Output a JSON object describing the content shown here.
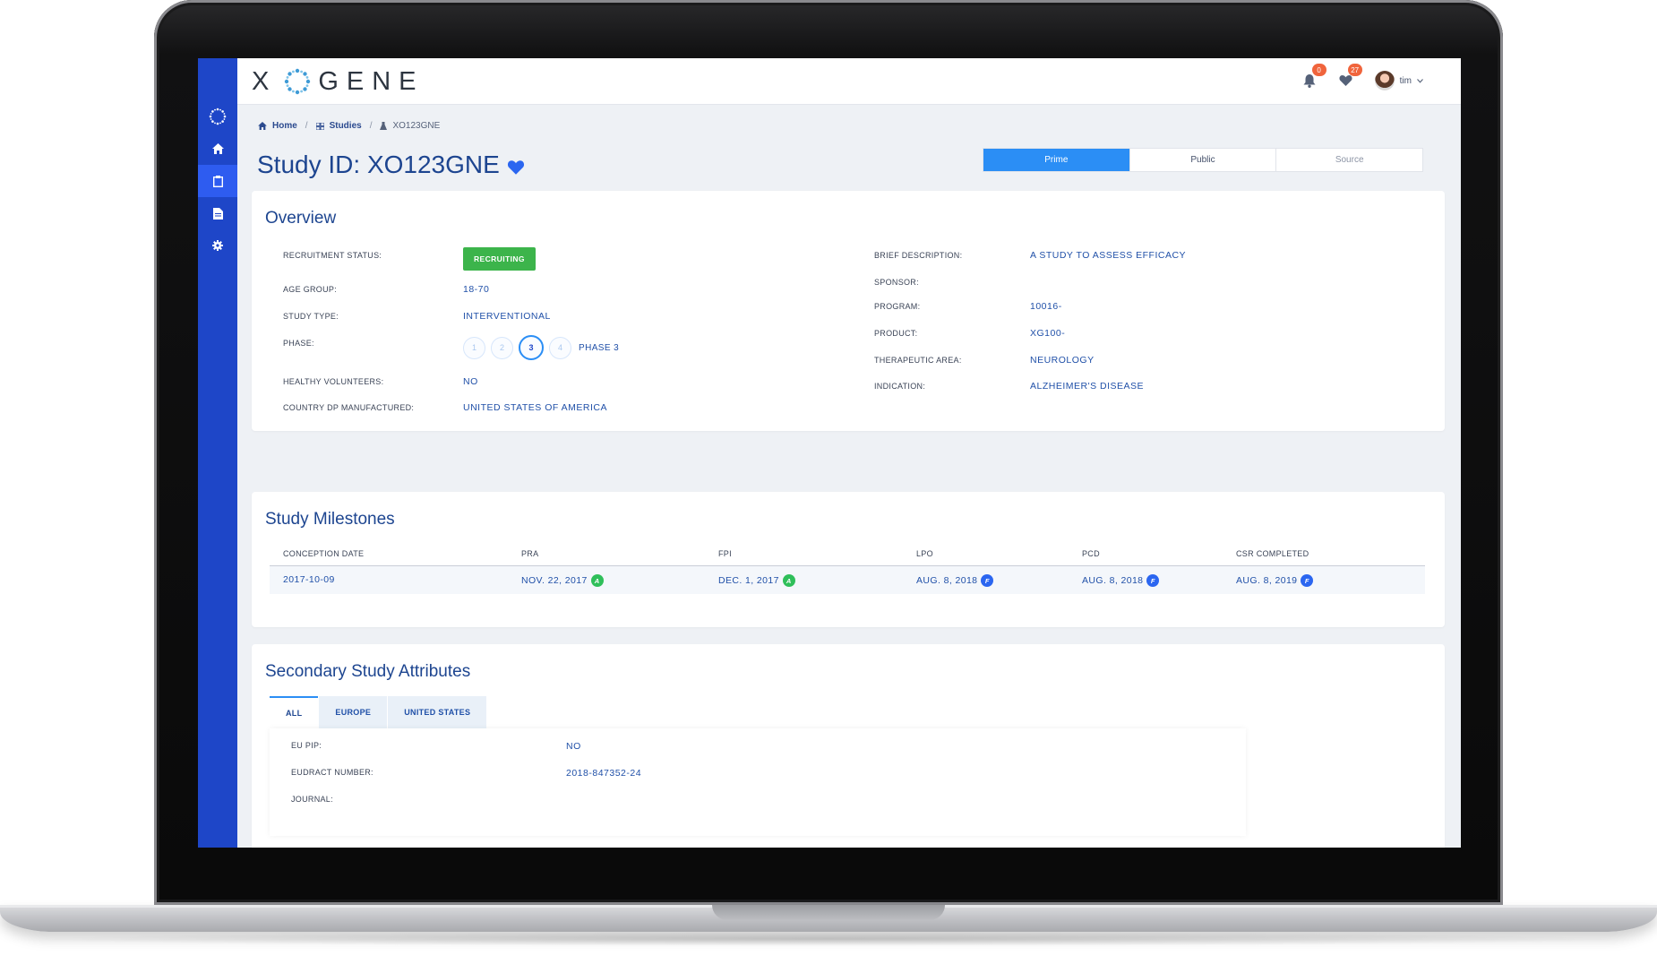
{
  "app": {
    "logo_left": "X",
    "logo_right": "GENE"
  },
  "topbar": {
    "notifications_count": "0",
    "messages_count": "27",
    "user_name": "tim"
  },
  "breadcrumb": {
    "home": "Home",
    "studies": "Studies",
    "current": "XO123GNE"
  },
  "page": {
    "title": "Study ID: XO123GNE"
  },
  "view_tabs": [
    "Prime",
    "Public",
    "Source"
  ],
  "overview": {
    "heading": "Overview",
    "left": [
      {
        "label": "RECRUITMENT STATUS:",
        "value": "RECRUITING"
      },
      {
        "label": "AGE GROUP:",
        "value": "18-70"
      },
      {
        "label": "STUDY TYPE:",
        "value": "INTERVENTIONAL"
      },
      {
        "label": "PHASE:",
        "value": "PHASE 3"
      },
      {
        "label": "HEALTHY VOLUNTEERS:",
        "value": "NO"
      },
      {
        "label": "COUNTRY DP MANUFACTURED:",
        "value": "UNITED STATES OF AMERICA"
      }
    ],
    "phase_steps": [
      "1",
      "2",
      "3",
      "4"
    ],
    "phase_selected": 3,
    "right": [
      {
        "label": "BRIEF DESCRIPTION:",
        "value": "A STUDY TO ASSESS EFFICACY"
      },
      {
        "label": "SPONSOR:",
        "value": ""
      },
      {
        "label": "PROGRAM:",
        "value": "10016-"
      },
      {
        "label": "PRODUCT:",
        "value": "XG100-"
      },
      {
        "label": "THERAPEUTIC AREA:",
        "value": "NEUROLOGY"
      },
      {
        "label": "INDICATION:",
        "value": "ALZHEIMER'S DISEASE"
      }
    ]
  },
  "milestones": {
    "heading": "Study Milestones",
    "columns": [
      "CONCEPTION DATE",
      "PRA",
      "FPI",
      "LPO",
      "PCD",
      "CSR COMPLETED"
    ],
    "row": [
      {
        "value": "2017-10-09",
        "flag": ""
      },
      {
        "value": "NOV. 22, 2017",
        "flag": "A"
      },
      {
        "value": "DEC. 1, 2017",
        "flag": "A"
      },
      {
        "value": "AUG. 8, 2018",
        "flag": "F"
      },
      {
        "value": "AUG. 8, 2018",
        "flag": "F"
      },
      {
        "value": "AUG. 8, 2019",
        "flag": "F"
      }
    ]
  },
  "secondary": {
    "heading": "Secondary Study Attributes",
    "tabs": [
      "ALL",
      "EUROPE",
      "UNITED STATES"
    ],
    "rows": [
      {
        "label": "EU PIP:",
        "value": "NO"
      },
      {
        "label": "EUDRACT NUMBER:",
        "value": "2018-847352-24"
      },
      {
        "label": "JOURNAL:",
        "value": ""
      }
    ]
  },
  "colors": {
    "sidebar": "#1e46c8",
    "accent": "#2b8ef5",
    "status_green": "#3cb44b",
    "title_blue": "#1d4590"
  }
}
